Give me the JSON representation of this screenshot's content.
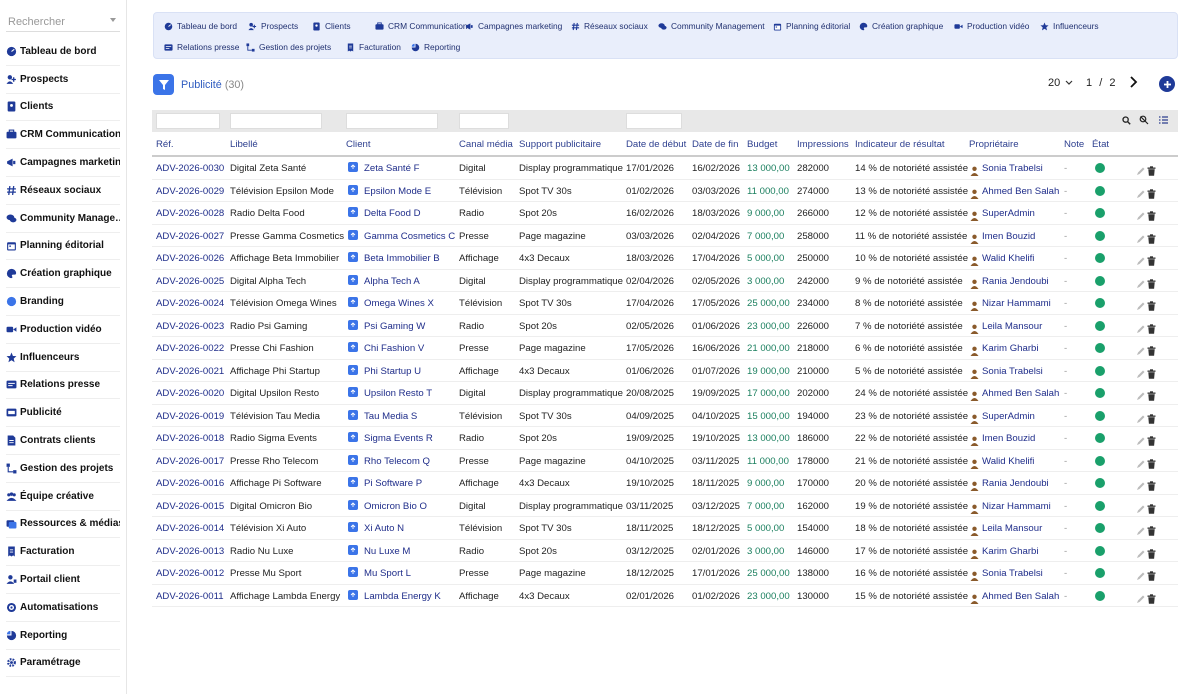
{
  "sidebar": {
    "search_placeholder": "Rechercher",
    "items": [
      {
        "label": "Tableau de bord",
        "icon": "dashboard-icon"
      },
      {
        "label": "Prospects",
        "icon": "user-plus-icon"
      },
      {
        "label": "Clients",
        "icon": "address-book-icon"
      },
      {
        "label": "CRM Communication",
        "icon": "crm-icon"
      },
      {
        "label": "Campagnes marketing",
        "icon": "megaphone-icon"
      },
      {
        "label": "Réseaux sociaux",
        "icon": "hashtag-icon"
      },
      {
        "label": "Community Manage…",
        "icon": "comments-icon"
      },
      {
        "label": "Planning éditorial",
        "icon": "calendar-icon"
      },
      {
        "label": "Création graphique",
        "icon": "palette-icon"
      },
      {
        "label": "Branding",
        "icon": "branding-icon"
      },
      {
        "label": "Production vidéo",
        "icon": "video-icon"
      },
      {
        "label": "Influenceurs",
        "icon": "star-icon"
      },
      {
        "label": "Relations presse",
        "icon": "press-icon"
      },
      {
        "label": "Publicité",
        "icon": "ad-icon"
      },
      {
        "label": "Contrats clients",
        "icon": "contract-icon"
      },
      {
        "label": "Gestion des projets",
        "icon": "project-icon"
      },
      {
        "label": "Équipe créative",
        "icon": "team-icon"
      },
      {
        "label": "Ressources & médias",
        "icon": "media-icon"
      },
      {
        "label": "Facturation",
        "icon": "invoice-icon"
      },
      {
        "label": "Portail client",
        "icon": "portal-icon"
      },
      {
        "label": "Automatisations",
        "icon": "automation-icon"
      },
      {
        "label": "Reporting",
        "icon": "chart-icon"
      },
      {
        "label": "Paramétrage",
        "icon": "gear-icon"
      }
    ]
  },
  "topmenu": {
    "items": [
      {
        "label": "Tableau de bord",
        "icon": "dashboard-icon"
      },
      {
        "label": "Prospects",
        "icon": "user-plus-icon"
      },
      {
        "label": "Clients",
        "icon": "address-book-icon"
      },
      {
        "label": "CRM Communication",
        "icon": "crm-icon"
      },
      {
        "label": "Campagnes marketing",
        "icon": "megaphone-icon"
      },
      {
        "label": "Réseaux sociaux",
        "icon": "hashtag-icon"
      },
      {
        "label": "Community Management",
        "icon": "comments-icon"
      },
      {
        "label": "Planning éditorial",
        "icon": "calendar-icon"
      },
      {
        "label": "Création graphique",
        "icon": "palette-icon"
      },
      {
        "label": "Production vidéo",
        "icon": "video-icon"
      },
      {
        "label": "Influenceurs",
        "icon": "star-icon"
      },
      {
        "label": "Relations presse",
        "icon": "press-icon"
      },
      {
        "label": "Gestion des projets",
        "icon": "project-icon"
      },
      {
        "label": "Facturation",
        "icon": "invoice-icon"
      },
      {
        "label": "Reporting",
        "icon": "chart-icon"
      }
    ]
  },
  "header": {
    "title": "Publicité",
    "count": "(30)",
    "per_page": "20",
    "page_current": "1",
    "page_sep": "/",
    "page_total": "2"
  },
  "table": {
    "columns": [
      "Réf.",
      "Libellé",
      "Client",
      "Canal média",
      "Support publicitaire",
      "Date de début",
      "Date de fin",
      "Budget",
      "Impressions",
      "Indicateur de résultat",
      "Propriétaire",
      "Note",
      "État"
    ],
    "rows": [
      [
        "ADV-2026-0030",
        "Digital Zeta Santé",
        "Zeta Santé F",
        "Digital",
        "Display programmatique",
        "17/01/2026",
        "16/02/2026",
        "13 000,00",
        "282000",
        "14 % de notoriété assistée",
        "Sonia Trabelsi",
        "-"
      ],
      [
        "ADV-2026-0029",
        "Télévision Epsilon Mode",
        "Epsilon Mode E",
        "Télévision",
        "Spot TV 30s",
        "01/02/2026",
        "03/03/2026",
        "11 000,00",
        "274000",
        "13 % de notoriété assistée",
        "Ahmed Ben Salah",
        "-"
      ],
      [
        "ADV-2026-0028",
        "Radio Delta Food",
        "Delta Food D",
        "Radio",
        "Spot 20s",
        "16/02/2026",
        "18/03/2026",
        "9 000,00",
        "266000",
        "12 % de notoriété assistée",
        "SuperAdmin",
        "-"
      ],
      [
        "ADV-2026-0027",
        "Presse Gamma Cosmetics",
        "Gamma Cosmetics C",
        "Presse",
        "Page magazine",
        "03/03/2026",
        "02/04/2026",
        "7 000,00",
        "258000",
        "11 % de notoriété assistée",
        "Imen Bouzid",
        "-"
      ],
      [
        "ADV-2026-0026",
        "Affichage Beta Immobilier",
        "Beta Immobilier B",
        "Affichage",
        "4x3 Decaux",
        "18/03/2026",
        "17/04/2026",
        "5 000,00",
        "250000",
        "10 % de notoriété assistée",
        "Walid Khelifi",
        "-"
      ],
      [
        "ADV-2026-0025",
        "Digital Alpha Tech",
        "Alpha Tech A",
        "Digital",
        "Display programmatique",
        "02/04/2026",
        "02/05/2026",
        "3 000,00",
        "242000",
        "9 % de notoriété assistée",
        "Rania Jendoubi",
        "-"
      ],
      [
        "ADV-2026-0024",
        "Télévision Omega Wines",
        "Omega Wines X",
        "Télévision",
        "Spot TV 30s",
        "17/04/2026",
        "17/05/2026",
        "25 000,00",
        "234000",
        "8 % de notoriété assistée",
        "Nizar Hammami",
        "-"
      ],
      [
        "ADV-2026-0023",
        "Radio Psi Gaming",
        "Psi Gaming W",
        "Radio",
        "Spot 20s",
        "02/05/2026",
        "01/06/2026",
        "23 000,00",
        "226000",
        "7 % de notoriété assistée",
        "Leila Mansour",
        "-"
      ],
      [
        "ADV-2026-0022",
        "Presse Chi Fashion",
        "Chi Fashion V",
        "Presse",
        "Page magazine",
        "17/05/2026",
        "16/06/2026",
        "21 000,00",
        "218000",
        "6 % de notoriété assistée",
        "Karim Gharbi",
        "-"
      ],
      [
        "ADV-2026-0021",
        "Affichage Phi Startup",
        "Phi Startup U",
        "Affichage",
        "4x3 Decaux",
        "01/06/2026",
        "01/07/2026",
        "19 000,00",
        "210000",
        "5 % de notoriété assistée",
        "Sonia Trabelsi",
        "-"
      ],
      [
        "ADV-2026-0020",
        "Digital Upsilon Resto",
        "Upsilon Resto T",
        "Digital",
        "Display programmatique",
        "20/08/2025",
        "19/09/2025",
        "17 000,00",
        "202000",
        "24 % de notoriété assistée",
        "Ahmed Ben Salah",
        "-"
      ],
      [
        "ADV-2026-0019",
        "Télévision Tau Media",
        "Tau Media S",
        "Télévision",
        "Spot TV 30s",
        "04/09/2025",
        "04/10/2025",
        "15 000,00",
        "194000",
        "23 % de notoriété assistée",
        "SuperAdmin",
        "-"
      ],
      [
        "ADV-2026-0018",
        "Radio Sigma Events",
        "Sigma Events R",
        "Radio",
        "Spot 20s",
        "19/09/2025",
        "19/10/2025",
        "13 000,00",
        "186000",
        "22 % de notoriété assistée",
        "Imen Bouzid",
        "-"
      ],
      [
        "ADV-2026-0017",
        "Presse Rho Telecom",
        "Rho Telecom Q",
        "Presse",
        "Page magazine",
        "04/10/2025",
        "03/11/2025",
        "11 000,00",
        "178000",
        "21 % de notoriété assistée",
        "Walid Khelifi",
        "-"
      ],
      [
        "ADV-2026-0016",
        "Affichage Pi Software",
        "Pi Software P",
        "Affichage",
        "4x3 Decaux",
        "19/10/2025",
        "18/11/2025",
        "9 000,00",
        "170000",
        "20 % de notoriété assistée",
        "Rania Jendoubi",
        "-"
      ],
      [
        "ADV-2026-0015",
        "Digital Omicron Bio",
        "Omicron Bio O",
        "Digital",
        "Display programmatique",
        "03/11/2025",
        "03/12/2025",
        "7 000,00",
        "162000",
        "19 % de notoriété assistée",
        "Nizar Hammami",
        "-"
      ],
      [
        "ADV-2026-0014",
        "Télévision Xi Auto",
        "Xi Auto N",
        "Télévision",
        "Spot TV 30s",
        "18/11/2025",
        "18/12/2025",
        "5 000,00",
        "154000",
        "18 % de notoriété assistée",
        "Leila Mansour",
        "-"
      ],
      [
        "ADV-2026-0013",
        "Radio Nu Luxe",
        "Nu Luxe M",
        "Radio",
        "Spot 20s",
        "03/12/2025",
        "02/01/2026",
        "3 000,00",
        "146000",
        "17 % de notoriété assistée",
        "Karim Gharbi",
        "-"
      ],
      [
        "ADV-2026-0012",
        "Presse Mu Sport",
        "Mu Sport L",
        "Presse",
        "Page magazine",
        "18/12/2025",
        "17/01/2026",
        "25 000,00",
        "138000",
        "16 % de notoriété assistée",
        "Sonia Trabelsi",
        "-"
      ],
      [
        "ADV-2026-0011",
        "Affichage Lambda Energy",
        "Lambda Energy K",
        "Affichage",
        "4x3 Decaux",
        "02/01/2026",
        "01/02/2026",
        "23 000,00",
        "130000",
        "15 % de notoriété assistée",
        "Ahmed Ben Salah",
        "-"
      ]
    ]
  },
  "colors": {
    "accent": "#3b74e8",
    "status_green": "#1aa06b",
    "link": "#1f2d8a",
    "budget": "#1a7f5e"
  }
}
